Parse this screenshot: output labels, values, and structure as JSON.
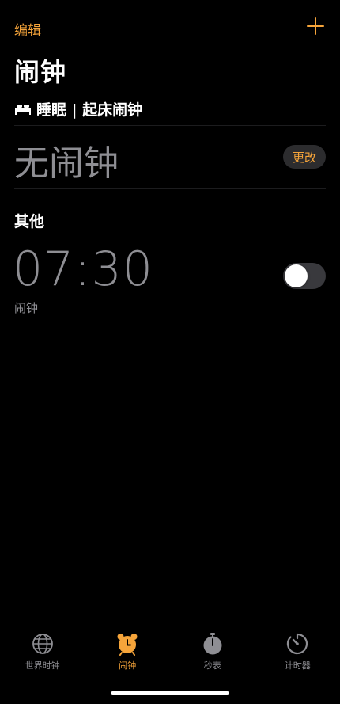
{
  "colors": {
    "accent": "#f5a43a",
    "secondary_text": "#8e8e93",
    "background": "#000000"
  },
  "nav": {
    "edit_label": "编辑",
    "add_icon": "plus-icon"
  },
  "page": {
    "title": "闹钟"
  },
  "sleep_section": {
    "icon": "bed-icon",
    "header": "睡眠 | 起床闹钟",
    "status": "无闹钟",
    "change_label": "更改"
  },
  "other_section": {
    "header": "其他",
    "alarms": [
      {
        "time": "07:30",
        "label": "闹钟",
        "enabled": false
      }
    ]
  },
  "tabbar": {
    "tabs": [
      {
        "label": "世界时钟",
        "icon": "globe-icon",
        "active": false
      },
      {
        "label": "闹钟",
        "icon": "alarm-clock-icon",
        "active": true
      },
      {
        "label": "秒表",
        "icon": "stopwatch-icon",
        "active": false
      },
      {
        "label": "计时器",
        "icon": "timer-icon",
        "active": false
      }
    ]
  }
}
